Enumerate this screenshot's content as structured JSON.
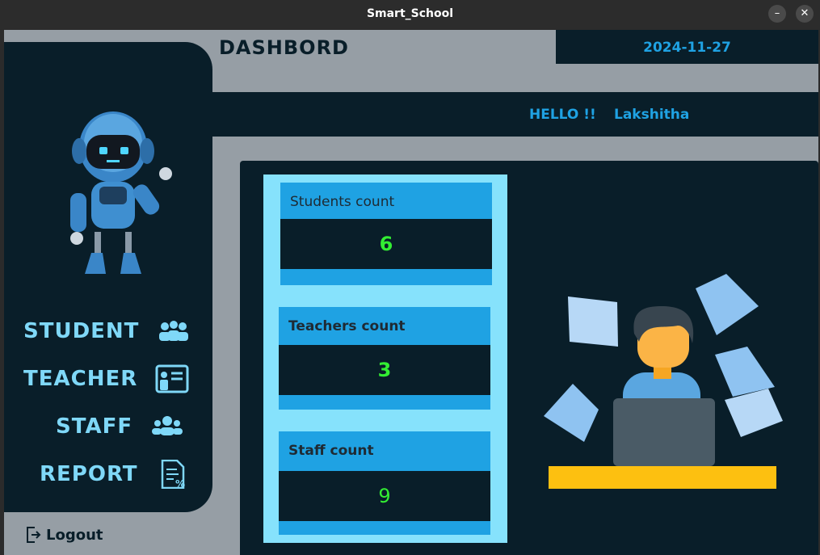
{
  "window": {
    "title": "Smart_School",
    "minimize_icon": "–",
    "close_icon": "✕"
  },
  "header": {
    "title": "DASHBORD",
    "date": "2024-11-27"
  },
  "greeting": {
    "hello": "HELLO !!",
    "user": "Lakshitha"
  },
  "sidebar": {
    "items": [
      {
        "label": "STUDENT",
        "icon": "students-group-icon"
      },
      {
        "label": "TEACHER",
        "icon": "teacher-board-icon"
      },
      {
        "label": "STAFF",
        "icon": "staff-group-icon"
      },
      {
        "label": "REPORT",
        "icon": "report-document-icon"
      }
    ],
    "logout_label": "Logout"
  },
  "stats": [
    {
      "label": "Students  count",
      "value": "6"
    },
    {
      "label": "Teachers  count",
      "value": "3"
    },
    {
      "label": "Staff  count",
      "value": "9"
    }
  ],
  "colors": {
    "dark": "#091e29",
    "accent": "#1fa2e3",
    "light": "#86e2fc",
    "gray": "#969ea5",
    "value_green": "#33ee33",
    "nav_text": "#7fd8f8"
  }
}
